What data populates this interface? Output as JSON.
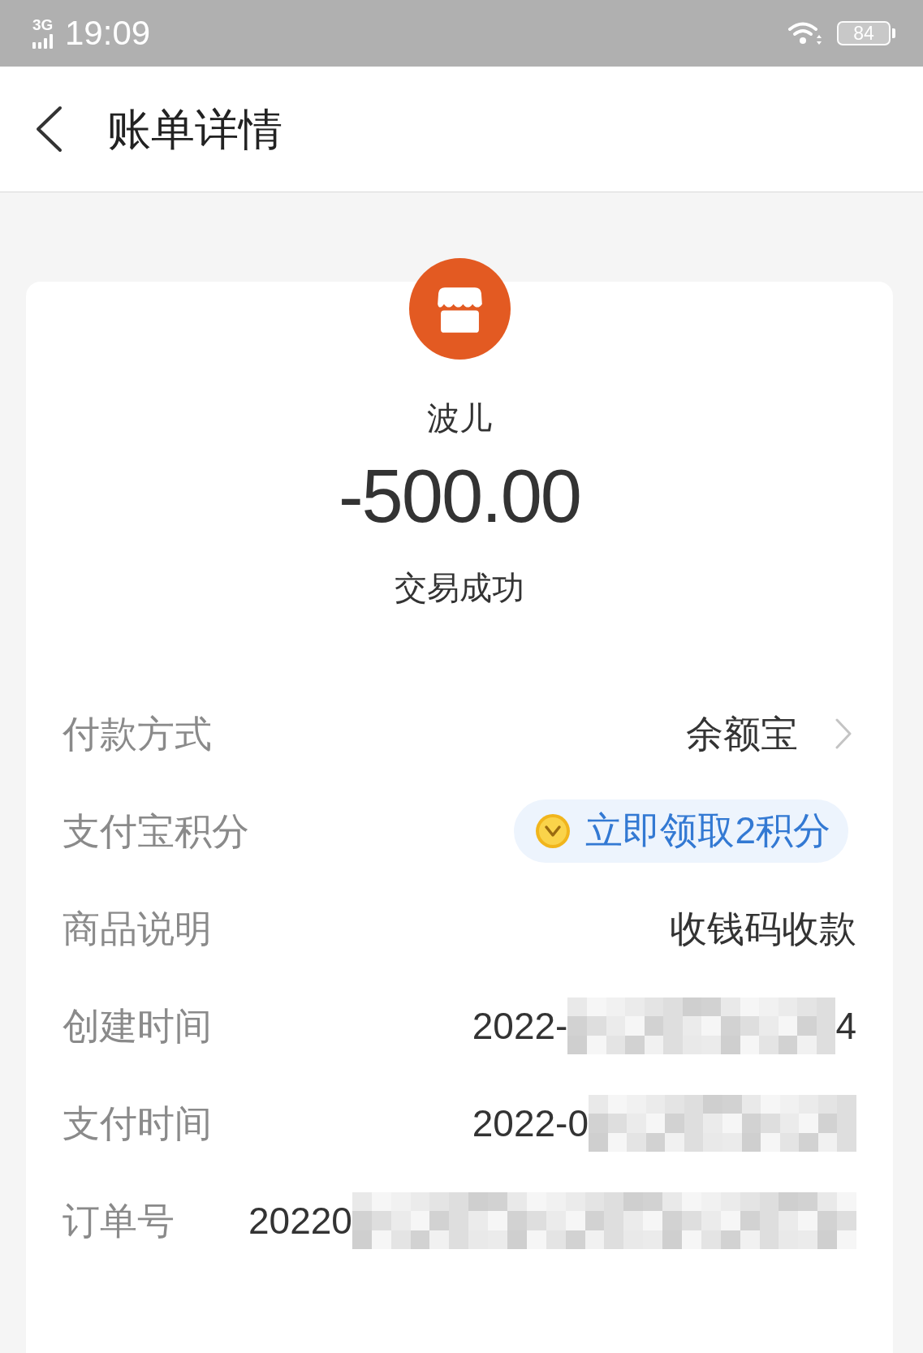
{
  "status_bar": {
    "network": "3G",
    "time": "19:09",
    "battery": "84"
  },
  "header": {
    "title": "账单详情"
  },
  "merchant": {
    "name": "波儿",
    "amount": "-500.00",
    "status": "交易成功"
  },
  "details": [
    {
      "kind": "link",
      "label": "付款方式",
      "value": "余额宝"
    },
    {
      "kind": "reward",
      "label": "支付宝积分",
      "value": "立即领取2积分"
    },
    {
      "kind": "text",
      "label": "商品说明",
      "value": "收钱码收款"
    },
    {
      "kind": "masked",
      "label": "创建时间",
      "value": "2022-",
      "value_end": "4"
    },
    {
      "kind": "masked",
      "label": "支付时间",
      "value": "2022-0"
    },
    {
      "kind": "masked_wide",
      "label": "订单号",
      "value": "20220"
    }
  ]
}
